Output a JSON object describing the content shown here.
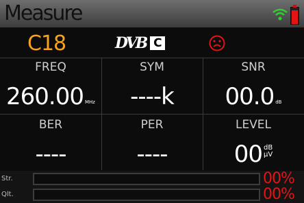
{
  "header": {
    "title": "Measure"
  },
  "status": {
    "channel": "C18",
    "standard_logo": "DVB",
    "standard_variant": "C",
    "lock_icon": "sad-face-icon",
    "colors": {
      "channel": "#f6a21e",
      "alert": "#e41414"
    }
  },
  "metrics": {
    "freq": {
      "label": "FREQ",
      "value": "260.00",
      "unit": "MHz"
    },
    "sym": {
      "label": "SYM",
      "value": "----k"
    },
    "snr": {
      "label": "SNR",
      "value": "00.0",
      "unit": "dB"
    },
    "ber": {
      "label": "BER",
      "value": "----"
    },
    "per": {
      "label": "PER",
      "value": "----"
    },
    "level": {
      "label": "LEVEL",
      "value": "00",
      "unit_top": "dB",
      "unit_bottom": "µV"
    }
  },
  "bars": {
    "strength": {
      "label": "Str.",
      "percent_text": "00%",
      "fraction": 0.0
    },
    "quality": {
      "label": "Qlt.",
      "percent_text": "00%",
      "fraction": 0.0
    }
  }
}
